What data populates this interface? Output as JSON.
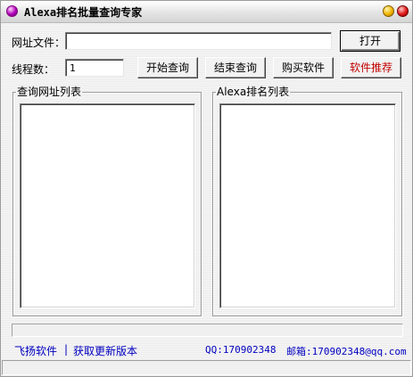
{
  "window": {
    "title": "Alexa排名批量查询专家"
  },
  "form": {
    "url_file_label": "网址文件：",
    "url_file_value": "",
    "open_button": "打开",
    "threads_label": "线程数：",
    "threads_value": "1",
    "start_button": "开始查询",
    "stop_button": "结束查询",
    "buy_button": "购买软件",
    "recommend_button": "软件推荐"
  },
  "lists": {
    "url_list_title": "查询网址列表",
    "rank_list_title": "Alexa排名列表"
  },
  "footer": {
    "brand_link": "飞扬软件",
    "separator": "|",
    "update_link": "获取更新版本",
    "qq": "QQ:170902348",
    "email": "邮箱:170902348@qq.com"
  },
  "colors": {
    "link": "#0000c0",
    "recommend": "#c00000",
    "icon": "#b000b8"
  }
}
